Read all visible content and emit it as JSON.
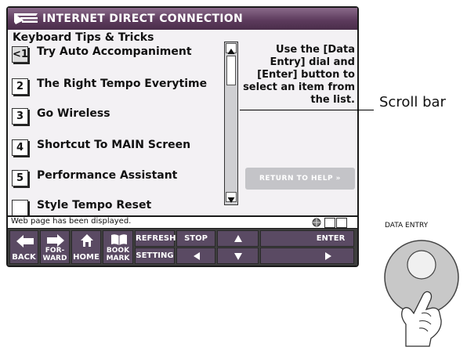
{
  "app": {
    "title": "INTERNET DIRECT CONNECTION"
  },
  "page": {
    "heading": "Keyboard Tips & Tricks"
  },
  "list": {
    "items": [
      {
        "num": "<1",
        "label": "Try Auto Accompaniment",
        "selected": true
      },
      {
        "num": "2",
        "label": "The Right Tempo Everytime"
      },
      {
        "num": "3",
        "label": "Go Wireless"
      },
      {
        "num": "4",
        "label": "Shortcut To MAIN Screen"
      },
      {
        "num": "5",
        "label": "Performance Assistant"
      },
      {
        "num": "",
        "label": "Style Tempo Reset"
      }
    ]
  },
  "help": {
    "text": "Use the [Data Entry] dial and [Enter] button to select an item from the list."
  },
  "return_button": {
    "label": "RETURN TO HELP »"
  },
  "status": {
    "message": "Web page has been displayed."
  },
  "toolbar": {
    "back": "BACK",
    "forward": "FOR-WARD",
    "home": "HOME",
    "bookmark": "BOOK MARK",
    "refresh": "REFRESH",
    "setting": "SETTING",
    "stop": "STOP",
    "enter": "ENTER"
  },
  "annotations": {
    "scroll_bar": "Scroll bar",
    "data_entry": "DATA ENTRY"
  },
  "colors": {
    "title_bar": "#5e3c5e",
    "toolbar_button": "#5a4a63",
    "content_bg": "#f3f1f4",
    "dial": "#c8c8c8"
  }
}
